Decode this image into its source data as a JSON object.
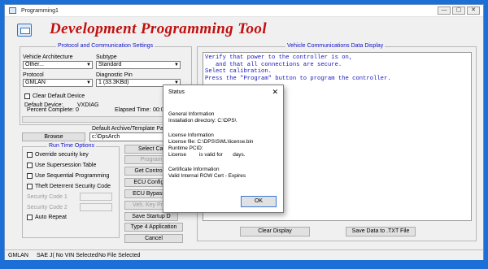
{
  "window": {
    "title": "Programming1",
    "banner": "Development Programming Tool",
    "controls": {
      "minimize": "—",
      "maximize": "▢",
      "close": "✕"
    }
  },
  "protocol_group": {
    "title": "Protocol and Communication Settings",
    "vehicle_architecture_label": "Vehicle Architecture",
    "vehicle_architecture_value": "Other...",
    "subtype_label": "Subtype",
    "subtype_value": "Standard",
    "protocol_label": "Protocol",
    "protocol_value": "GMLAN",
    "diagnostic_pin_label": "Diagnostic Pin",
    "diagnostic_pin_value": "1 (33.3KBd)",
    "clear_default_device_label": "Clear Default Device",
    "default_device_label": "Default Device:",
    "default_device_value": "VXDIAG"
  },
  "progress": {
    "percent_complete_label": "Percent Complete:",
    "percent_complete_value": "0",
    "elapsed_time_label": "Elapsed Time:",
    "elapsed_time_value": "00:0"
  },
  "archive": {
    "title": "Default Archive/Template Path",
    "browse_label": "Browse",
    "path_value": "c:\\DpsArch"
  },
  "run_time": {
    "title": "Run Time Options",
    "options": [
      "Override security key",
      "Use Supersession Table",
      "Use Sequential Programming",
      "Theft Deterrent Security Code"
    ],
    "security_code_1_label": "Security Code 1",
    "security_code_2_label": "Security Code 2",
    "auto_repeat_label": "Auto Repeat"
  },
  "actions": {
    "select_cal": "Select Cal",
    "program": "Program",
    "get_controller": "Get Controlle",
    "ecu_config": "ECU Configur",
    "ecu_bypass": "ECU Bypass T",
    "veh_key_prov": "Veh. Key Provi",
    "save_startup": "Save Startup D",
    "type4": "Type 4 Application",
    "cancel": "Cancel"
  },
  "vcd": {
    "title": "Vehicle Communications Data Display",
    "lines": [
      "Verify that power to the controller is on,",
      "   and that all connections are secure.",
      "Select calibration.",
      "Press the \"Program\" button to program the controller."
    ],
    "clear_display": "Clear Display",
    "save_txt": "Save Data to .TXT File"
  },
  "status_bar": {
    "protocol": "GMLAN",
    "vin": "SAE J( No VIN Selected",
    "file": "No File Selected"
  },
  "dialog": {
    "title": "Status",
    "close": "✕",
    "general_header": "General Information",
    "install_dir": "Installation directory: C:\\DPS\\",
    "license_header": "License Information",
    "license_file": "License file: C:\\DPS\\SWL\\license.bin",
    "runtime_pcid": "Runtime PCID:",
    "license_valid": "License         is valid for       days.",
    "cert_header": "Certificate Information",
    "cert_value": "Valid Internal ROW Cert - Expires",
    "ok": "OK"
  }
}
